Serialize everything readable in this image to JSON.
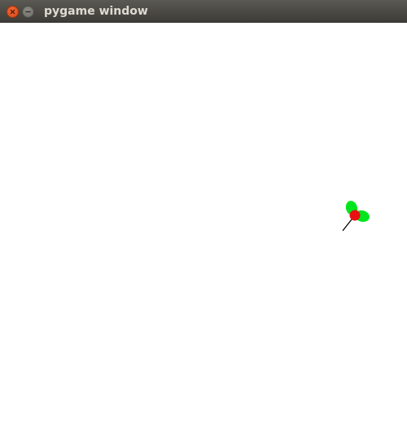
{
  "window": {
    "title": "pygame window",
    "controls": {
      "close_icon": "close-icon",
      "minimize_icon": "minimize-icon"
    }
  },
  "scene": {
    "background": "#ffffff",
    "sprite": {
      "body_color": "#e81010",
      "leaf_color": "#00e61e",
      "line_color": "#000000"
    }
  }
}
